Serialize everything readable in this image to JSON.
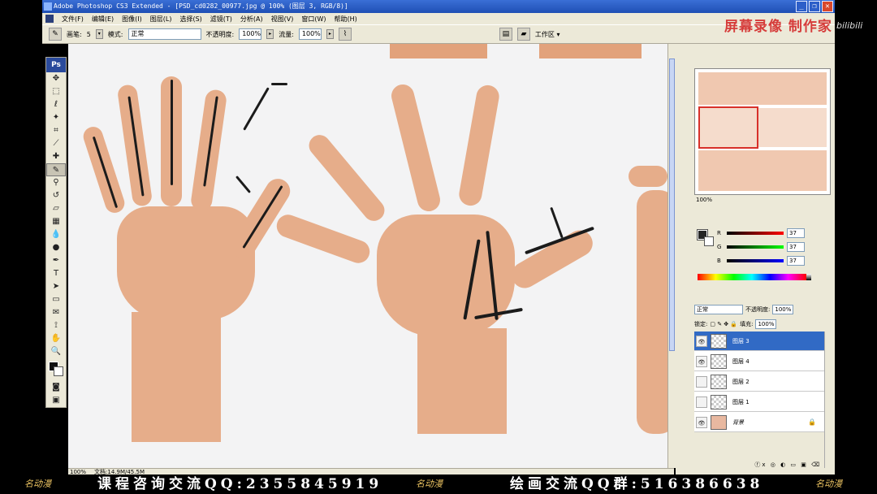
{
  "app": {
    "title": "Adobe Photoshop CS3 Extended - [PSD_cd0282_00977.jpg @ 100% (图层 3, RGB/8)]"
  },
  "window_buttons": [
    "_",
    "❐",
    "✕"
  ],
  "menu": [
    "文件(F)",
    "编辑(E)",
    "图像(I)",
    "图层(L)",
    "选择(S)",
    "滤镜(T)",
    "分析(A)",
    "视图(V)",
    "窗口(W)",
    "帮助(H)"
  ],
  "options_bar": {
    "brush_label": "画笔:",
    "brush_size": "5",
    "mode_label": "模式:",
    "mode_value": "正常",
    "opacity_label": "不透明度:",
    "opacity_value": "100%",
    "flow_label": "流量:",
    "flow_value": "100%",
    "workspace_label": "工作区 ▾"
  },
  "toolbox": {
    "logo": "Ps",
    "tools": [
      {
        "name": "move-tool",
        "glyph": "✥"
      },
      {
        "name": "marquee-tool",
        "glyph": "⬚"
      },
      {
        "name": "lasso-tool",
        "glyph": "ℓ"
      },
      {
        "name": "magic-wand-tool",
        "glyph": "✦"
      },
      {
        "name": "crop-tool",
        "glyph": "⌗"
      },
      {
        "name": "slice-tool",
        "glyph": "⟋"
      },
      {
        "name": "healing-tool",
        "glyph": "✚"
      },
      {
        "name": "brush-tool",
        "glyph": "✎"
      },
      {
        "name": "stamp-tool",
        "glyph": "⚲"
      },
      {
        "name": "history-brush-tool",
        "glyph": "↺"
      },
      {
        "name": "eraser-tool",
        "glyph": "▱"
      },
      {
        "name": "gradient-tool",
        "glyph": "▦"
      },
      {
        "name": "blur-tool",
        "glyph": "💧"
      },
      {
        "name": "dodge-tool",
        "glyph": "●"
      },
      {
        "name": "pen-tool",
        "glyph": "✒"
      },
      {
        "name": "type-tool",
        "glyph": "T"
      },
      {
        "name": "path-select-tool",
        "glyph": "➤"
      },
      {
        "name": "shape-tool",
        "glyph": "▭"
      },
      {
        "name": "notes-tool",
        "glyph": "✉"
      },
      {
        "name": "eyedropper-tool",
        "glyph": "⟟"
      },
      {
        "name": "hand-tool",
        "glyph": "✋"
      },
      {
        "name": "zoom-tool",
        "glyph": "🔍"
      }
    ]
  },
  "status_bar": {
    "zoom": "100%",
    "doc_info": "文档:14.9M/45.5M"
  },
  "navigator": {
    "zoom": "100%"
  },
  "color_panel": {
    "r_label": "R",
    "r_value": "37",
    "g_label": "G",
    "g_value": "37",
    "b_label": "B",
    "b_value": "37"
  },
  "layers_panel": {
    "blend_mode": "正常",
    "opacity_label": "不透明度:",
    "opacity_value": "100%",
    "lock_label": "锁定:",
    "fill_label": "填充:",
    "fill_value": "100%",
    "layers": [
      {
        "name": "图层 3",
        "visible": true,
        "selected": true
      },
      {
        "name": "图层 4",
        "visible": true,
        "selected": false
      },
      {
        "name": "图层 2",
        "visible": false,
        "selected": false
      },
      {
        "name": "图层 1",
        "visible": false,
        "selected": false
      },
      {
        "name": "背景",
        "visible": true,
        "selected": false,
        "locked": true
      }
    ],
    "bottom_icons": "ⓕx ◎ ◐ ▭ ▣ ⌫"
  },
  "overlay": {
    "watermark": "屏幕录像 制作家",
    "bilibili": "bilibili",
    "promo_left": "课程咨询交流QQ:2355845919",
    "promo_right": "绘画交流QQ群:516386638",
    "promo_logo": "名动漫"
  },
  "colors": {
    "title_blue": "#1f4fb4",
    "chrome": "#ece9d8",
    "selection": "#316ac5",
    "skin": "#e6ad8a"
  }
}
